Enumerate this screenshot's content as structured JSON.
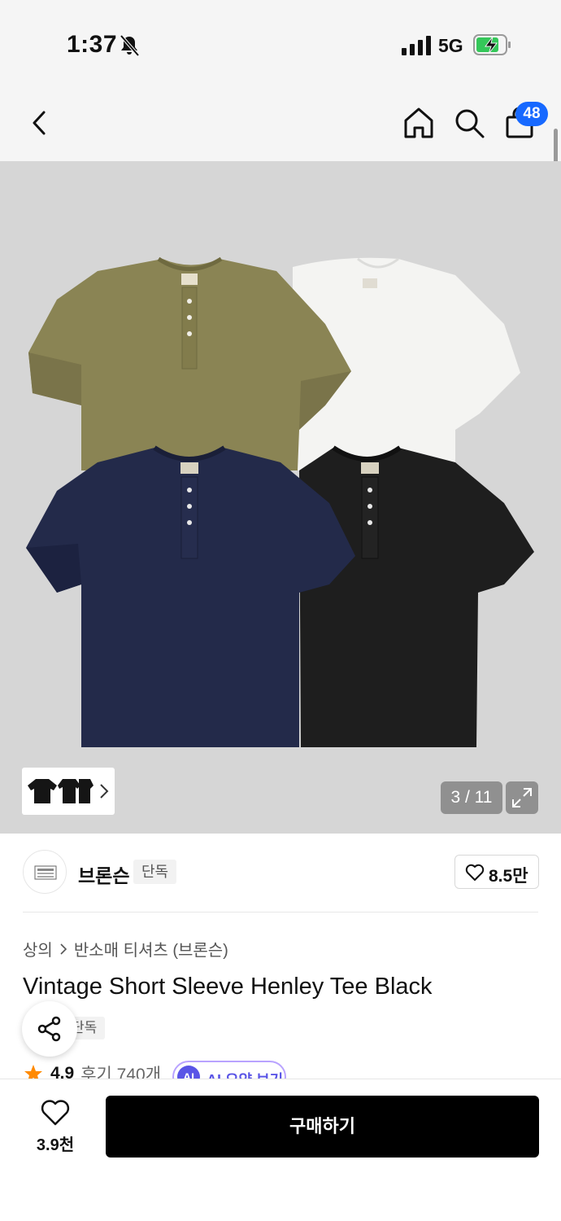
{
  "status_bar": {
    "time": "1:37",
    "network": "5G"
  },
  "nav": {
    "cart_count": "48"
  },
  "gallery": {
    "counter": "3 / 11"
  },
  "brand": {
    "name": "브론슨",
    "tag": "단독",
    "likes": "8.5만"
  },
  "breadcrumb": {
    "category": "상의",
    "subcategory": "반소매 티셔츠 (브론슨)"
  },
  "product": {
    "title": "Vintage Short Sleeve Henley Tee Black",
    "tag": "단독",
    "rating": "4.9",
    "review_label": "후기 740개",
    "ai_badge": "AI",
    "ai_summary_label": "AI 요약 보기"
  },
  "bottom_bar": {
    "wishlist_count": "3.9천",
    "buy_label": "구매하기"
  },
  "colors": {
    "accent_badge": "#1769ff",
    "ai_purple": "#5a55e6",
    "star": "#ff8a00",
    "shirt_olive": "#8a8454",
    "shirt_white": "#f4f4f2",
    "shirt_navy": "#232a4a",
    "shirt_black": "#1e1e1e"
  }
}
